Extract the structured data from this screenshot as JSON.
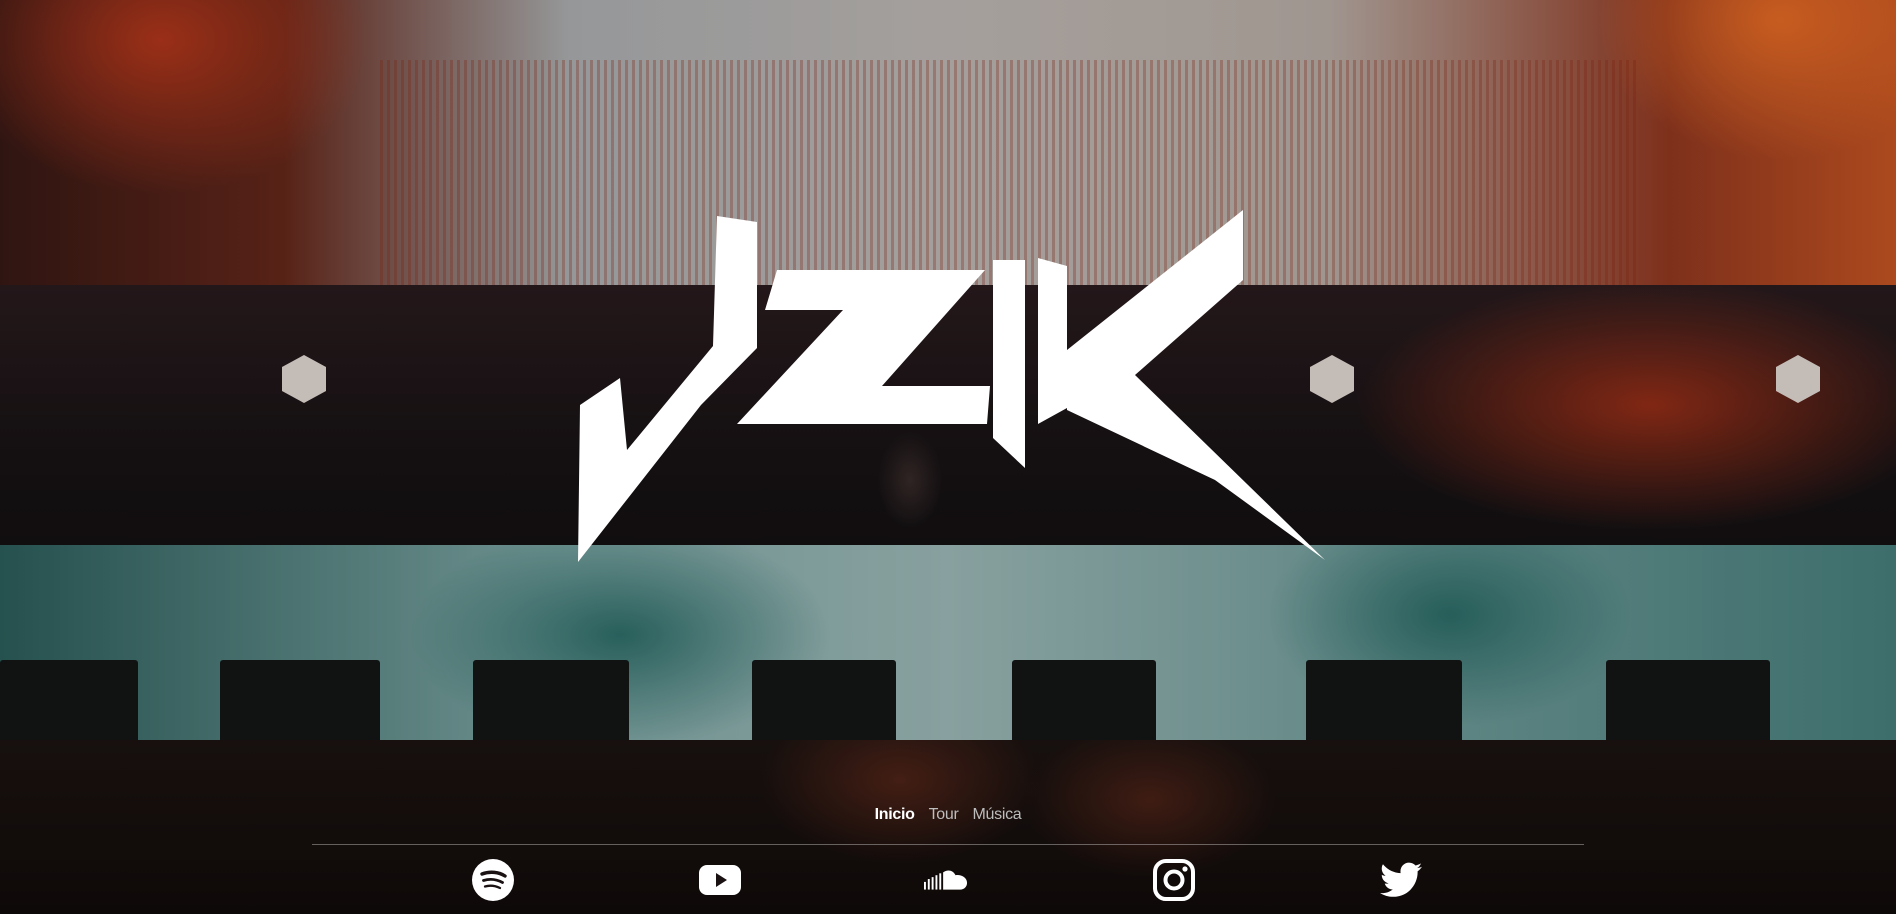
{
  "site": {
    "logo_text": "JZIK"
  },
  "nav": {
    "items": [
      {
        "label": "Inicio",
        "active": true
      },
      {
        "label": "Tour",
        "active": false
      },
      {
        "label": "Música",
        "active": false
      }
    ]
  },
  "social": {
    "icons": [
      "spotify-icon",
      "youtube-icon",
      "soundcloud-icon",
      "instagram-icon",
      "twitter-icon"
    ]
  },
  "colors": {
    "logo": "#ffffff",
    "nav_active": "#ffffff",
    "nav_inactive": "#bdbdbd",
    "icons": "#ffffff"
  }
}
